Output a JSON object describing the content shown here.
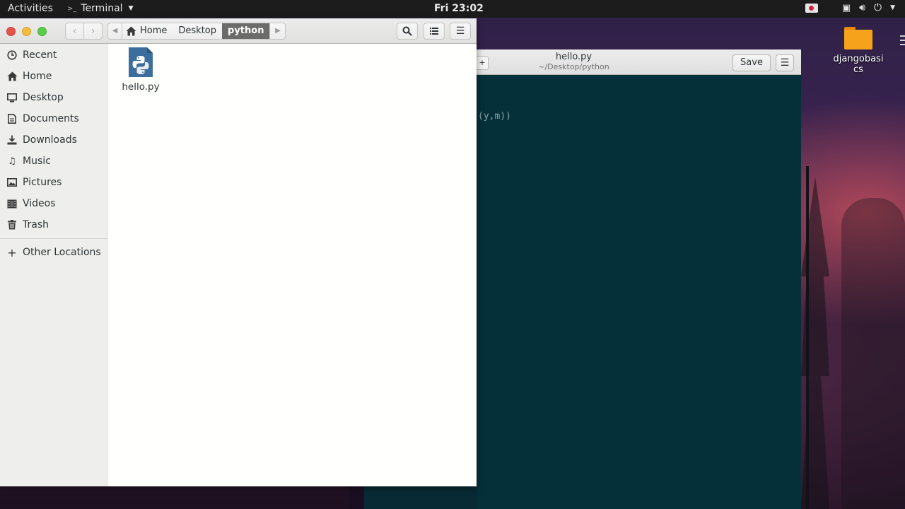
{
  "topbar": {
    "activities": "Activities",
    "app_name": "Terminal",
    "clock": "Fri 23:02"
  },
  "desktop": {
    "icons": [
      {
        "label": "djangobasics"
      }
    ]
  },
  "gedit": {
    "title": "hello.py",
    "subtitle": "~/Desktop/python",
    "save_label": "Save",
    "visible_code": "(y,m))"
  },
  "files": {
    "nav": {
      "back": "‹",
      "forward": "›"
    },
    "pathbar": [
      "Home",
      "Desktop",
      "python"
    ],
    "sidebar": {
      "items": [
        {
          "label": "Recent",
          "icon": "clock-icon"
        },
        {
          "label": "Home",
          "icon": "home-icon"
        },
        {
          "label": "Desktop",
          "icon": "desktop-icon"
        },
        {
          "label": "Documents",
          "icon": "document-icon"
        },
        {
          "label": "Downloads",
          "icon": "download-icon"
        },
        {
          "label": "Music",
          "icon": "music-icon"
        },
        {
          "label": "Pictures",
          "icon": "picture-icon"
        },
        {
          "label": "Videos",
          "icon": "video-icon"
        },
        {
          "label": "Trash",
          "icon": "trash-icon"
        }
      ],
      "other_locations": "Other Locations"
    },
    "content": {
      "items": [
        {
          "name": "hello.py",
          "icon": "python-file-icon"
        }
      ]
    }
  },
  "colors": {
    "topbar_bg": "#1c1c1c",
    "terminal_bg": "#05303a",
    "pathbar_active": "#6b6b69",
    "close": "#e9514b",
    "minimize": "#f2bd3b",
    "maximize": "#5ccd48",
    "folder": "#f7a21b",
    "python_file": "#3b6e9c"
  }
}
